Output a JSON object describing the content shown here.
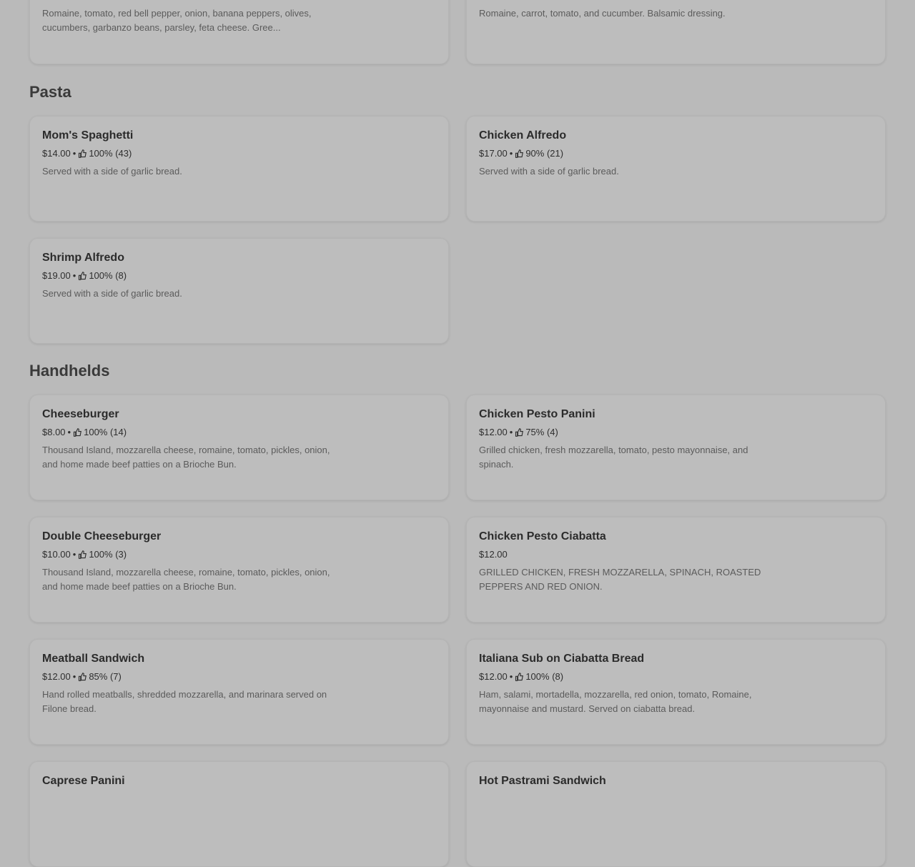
{
  "top_cards": {
    "left_desc": "Romaine, tomato, red bell pepper, onion, banana peppers, olives, cucumbers, garbanzo beans, parsley, feta cheese. Gree...",
    "right_desc": "Romaine, carrot, tomato, and cucumber. Balsamic dressing."
  },
  "sections": {
    "pasta": {
      "title": "Pasta",
      "items": [
        {
          "name": "Mom's Spaghetti",
          "price": "$14.00",
          "rating": "100% (43)",
          "desc": "Served with a side of garlic bread."
        },
        {
          "name": "Chicken Alfredo",
          "price": "$17.00",
          "rating": "90% (21)",
          "desc": "Served with a side of garlic bread."
        },
        {
          "name": "Shrimp Alfredo",
          "price": "$19.00",
          "rating": "100% (8)",
          "desc": "Served with a side of garlic bread."
        }
      ]
    },
    "handhelds": {
      "title": "Handhelds",
      "items": [
        {
          "name": "Cheeseburger",
          "price": "$8.00",
          "rating": "100% (14)",
          "desc": "Thousand Island, mozzarella cheese, romaine, tomato, pickles, onion, and home made beef patties on a Brioche Bun."
        },
        {
          "name": "Chicken Pesto Panini",
          "price": "$12.00",
          "rating": "75% (4)",
          "desc": "Grilled chicken, fresh mozzarella, tomato, pesto mayonnaise, and spinach."
        },
        {
          "name": "Double Cheeseburger",
          "price": "$10.00",
          "rating": "100% (3)",
          "desc": "Thousand Island, mozzarella cheese, romaine, tomato, pickles, onion, and home made beef patties on a Brioche Bun."
        },
        {
          "name": "Chicken Pesto Ciabatta",
          "price": "$12.00",
          "rating": "",
          "desc": "GRILLED CHICKEN, FRESH MOZZARELLA, SPINACH, ROASTED PEPPERS AND RED ONION."
        },
        {
          "name": "Meatball Sandwich",
          "price": "$12.00",
          "rating": "85% (7)",
          "desc": "Hand rolled meatballs, shredded mozzarella, and marinara served on Filone bread."
        },
        {
          "name": "Italiana Sub on Ciabatta Bread",
          "price": "$12.00",
          "rating": "100% (8)",
          "desc": "Ham, salami, mortadella, mozzarella, red onion, tomato, Romaine, mayonnaise and mustard. Served on ciabatta bread."
        },
        {
          "name": "Caprese Panini",
          "price": "",
          "rating": "",
          "desc": ""
        },
        {
          "name": "Hot Pastrami Sandwich",
          "price": "",
          "rating": "",
          "desc": ""
        }
      ]
    }
  },
  "icons": {
    "rating": "thumbs-up-icon"
  },
  "separator": "•"
}
